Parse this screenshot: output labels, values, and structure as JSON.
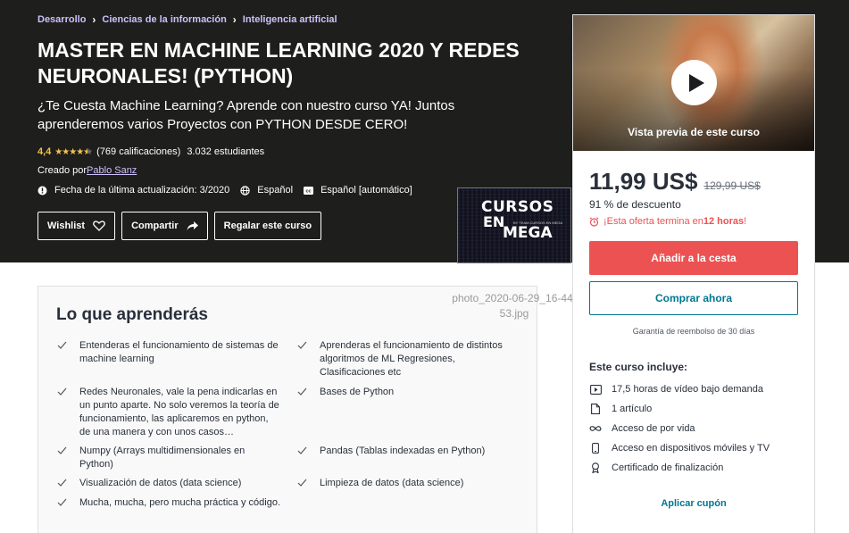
{
  "breadcrumb": [
    "Desarrollo",
    "Ciencias de la información",
    "Inteligencia artificial"
  ],
  "course": {
    "title": "MASTER EN MACHINE LEARNING 2020 Y REDES NEURONALES! (PYTHON)",
    "subtitle": "¿Te Cuesta Machine Learning? Aprende con nuestro curso YA! Juntos aprenderemos varios Proyectos con PYTHON DESDE CERO!",
    "rating": "4,4",
    "rating_stars": 4.4,
    "ratings_count": "(769 calificaciones)",
    "students": "3.032 estudiantes",
    "created_by_label": "Creado por",
    "author": "Pablo Sanz",
    "last_update": "Fecha de la última actualización: 3/2020",
    "language": "Español",
    "captions": "Español [automático]"
  },
  "actions": {
    "wishlist": "Wishlist",
    "share": "Compartir",
    "gift": "Regalar este curso"
  },
  "promo_image": {
    "line1": "CURSOS",
    "line2": "EN",
    "line3": "MEGA",
    "small": "BY TEAM CURSOS EN MEGA"
  },
  "photo_caption": "photo_2020-06-29_16-44-53.jpg",
  "learn": {
    "title": "Lo que aprenderás",
    "items": [
      "Entenderas el funcionamiento de sistemas de machine learning",
      "Aprenderas el funcionamiento de distintos algoritmos de ML Regresiones, Clasificaciones etc",
      "Redes Neuronales, vale la pena indicarlas en un punto aparte. No solo veremos la teoría de funcionamiento, las aplicaremos en python, de una manera y con unos casos…",
      "Bases de Python",
      "Numpy (Arrays multidimensionales en Python)",
      "Pandas (Tablas indexadas en Python)",
      "Visualización de datos (data science)",
      "Limpieza de datos (data science)",
      "Mucha, mucha, pero mucha práctica y código."
    ]
  },
  "sidebar": {
    "preview_label": "Vista previa de este curso",
    "price": "11,99 US$",
    "old_price": "129,99 US$",
    "discount": "91 % de descuento",
    "urgency_prefix": "¡Esta oferta termina en ",
    "urgency_time": "12 horas",
    "urgency_suffix": "!",
    "add_to_cart": "Añadir a la cesta",
    "buy_now": "Comprar ahora",
    "guarantee": "Garantía de reembolso de 30 días",
    "includes_title": "Este curso incluye:",
    "includes": [
      "17,5 horas de vídeo bajo demanda",
      "1 artículo",
      "Acceso de por vida",
      "Acceso en dispositivos móviles y TV",
      "Certificado de finalización"
    ],
    "coupon": "Aplicar cupón"
  },
  "colors": {
    "hero_bg": "#1e1e1c",
    "link_purple": "#cec0fc",
    "star": "#f4c150",
    "cta_red": "#ec5252",
    "teal": "#007791"
  }
}
